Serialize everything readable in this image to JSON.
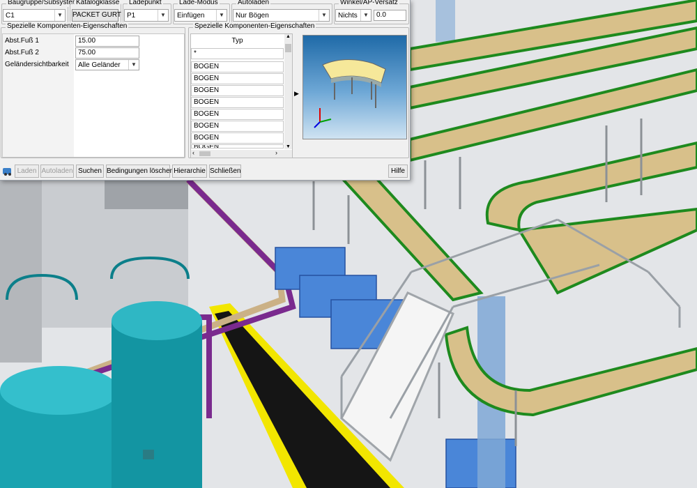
{
  "header_groups": {
    "baugruppe": {
      "title": "Baugruppe/Subsystem",
      "value": "C1"
    },
    "katalogklasse": {
      "title": "Katalogklasse",
      "value": "PACKET GURT"
    },
    "ladepunkt": {
      "title": "Ladepunkt",
      "value": "P1"
    },
    "lademodus": {
      "title": "Lade-Modus",
      "value": "Einfügen"
    },
    "autoladen": {
      "title": "Autoladen",
      "value": "Nur Bögen"
    },
    "winkel": {
      "title": "Winkel/AP-Versatz",
      "value": "Nichts",
      "offset": "0.0"
    }
  },
  "left_panel": {
    "title": "Spezielle Komponenten-Eigenschaften",
    "rows": [
      {
        "label": "Abst.Fuß 1",
        "value": "15.00"
      },
      {
        "label": "Abst.Fuß 2",
        "value": "75.00"
      },
      {
        "label": "Geländersichtbarkeit",
        "value": "Alle Geländer"
      }
    ]
  },
  "right_panel": {
    "title": "Spezielle Komponenten-Eigenschaften",
    "column_header": "Typ",
    "rows": [
      "*",
      "BOGEN",
      "BOGEN",
      "BOGEN",
      "BOGEN",
      "BOGEN",
      "BOGEN",
      "BOGEN",
      "BOGEN"
    ]
  },
  "toolbar": {
    "laden": "Laden",
    "autoladen": "Autoladen",
    "suchen": "Suchen",
    "bedingungen": "Bedingungen löschen",
    "hierarchie": "Hierarchie",
    "schliessen": "Schließen",
    "hilfe": "Hilfe"
  },
  "icons": [
    "app-icon",
    "chevron-down-icon",
    "scroll-up-icon",
    "scroll-down-icon",
    "scroll-left-icon",
    "scroll-right-icon",
    "expand-arrow-icon",
    "axis-triad-icon"
  ],
  "colors": {
    "conveyor_wood": "#d8c08a",
    "conveyor_frame": "#1e8a1e",
    "tank": "#1aa3b0",
    "pipe_purple": "#7a2a8e",
    "pipe_tan": "#cbb186",
    "cage_blue": "#4a86d8",
    "floor": "#e4e6e9",
    "walkway": "#151515",
    "walkway_edge": "#f2e600",
    "column_blue": "#7fa8d6"
  }
}
